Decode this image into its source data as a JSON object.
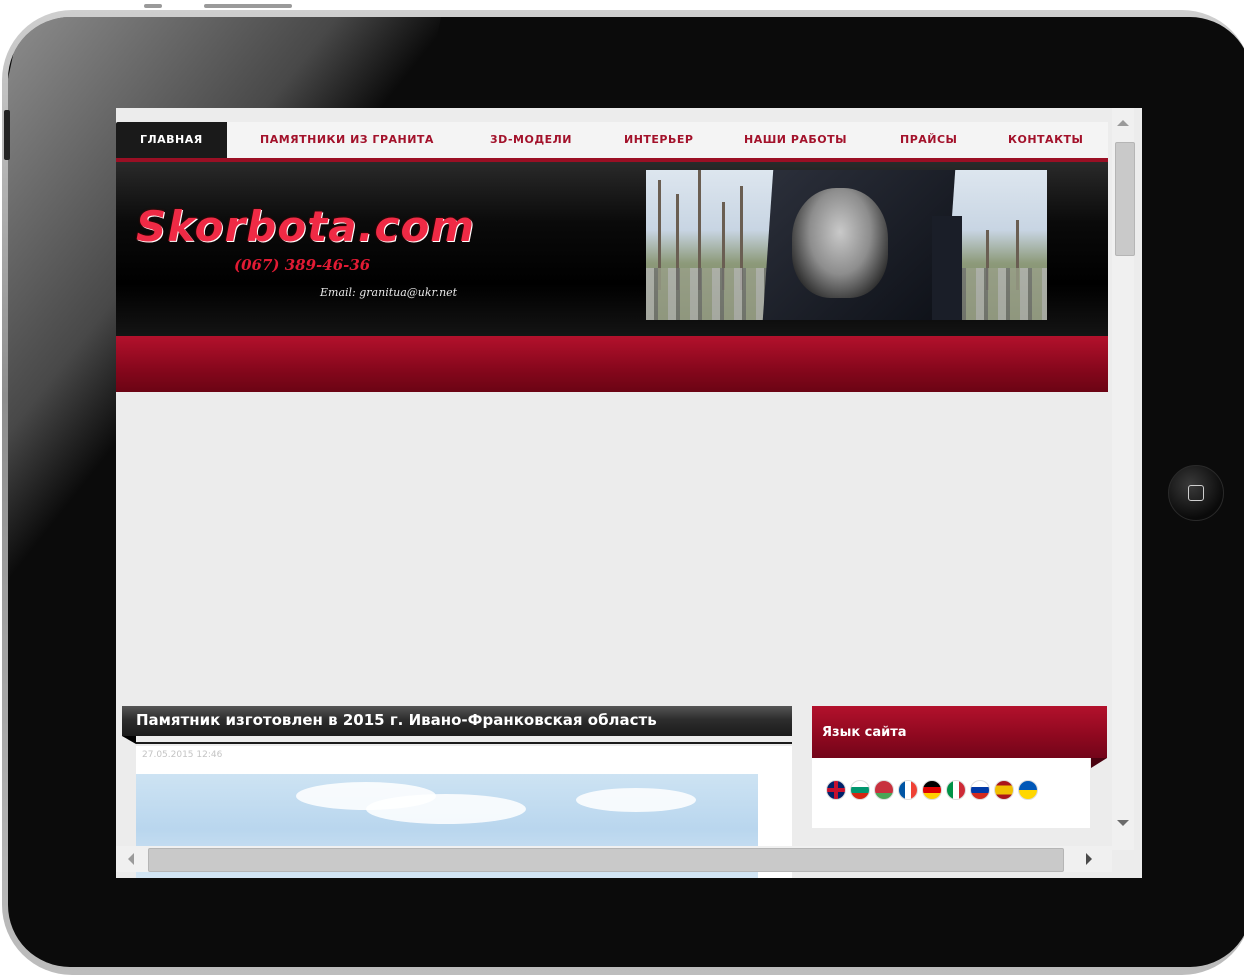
{
  "nav": {
    "items": [
      {
        "label": "ГЛАВНАЯ"
      },
      {
        "label": "ПАМЯТНИКИ ИЗ ГРАНИТА"
      },
      {
        "label": "3D-МОДЕЛИ"
      },
      {
        "label": "ИНТЕРЬЕР"
      },
      {
        "label": "НАШИ РАБОТЫ"
      },
      {
        "label": "ПРАЙСЫ"
      },
      {
        "label": "КОНТАКТЫ"
      }
    ],
    "active_index": 0
  },
  "header": {
    "logo": "Skorbota.com",
    "phone": "(067) 389-46-36",
    "email": "Email: granitua@ukr.net"
  },
  "article": {
    "title": "Памятник изготовлен в 2015 г. Ивано-Франковская область",
    "date": "27.05.2015 12:46"
  },
  "sidebar": {
    "language_title": "Язык сайта",
    "flags": [
      "uk-flag-icon",
      "bulgaria-flag-icon",
      "belarus-flag-icon",
      "france-flag-icon",
      "germany-flag-icon",
      "italy-flag-icon",
      "russia-flag-icon",
      "spain-flag-icon",
      "ukraine-flag-icon"
    ]
  },
  "colors": {
    "brand_red": "#a3122b",
    "header_black": "#0a0a0a",
    "page_bg": "#ececec"
  }
}
